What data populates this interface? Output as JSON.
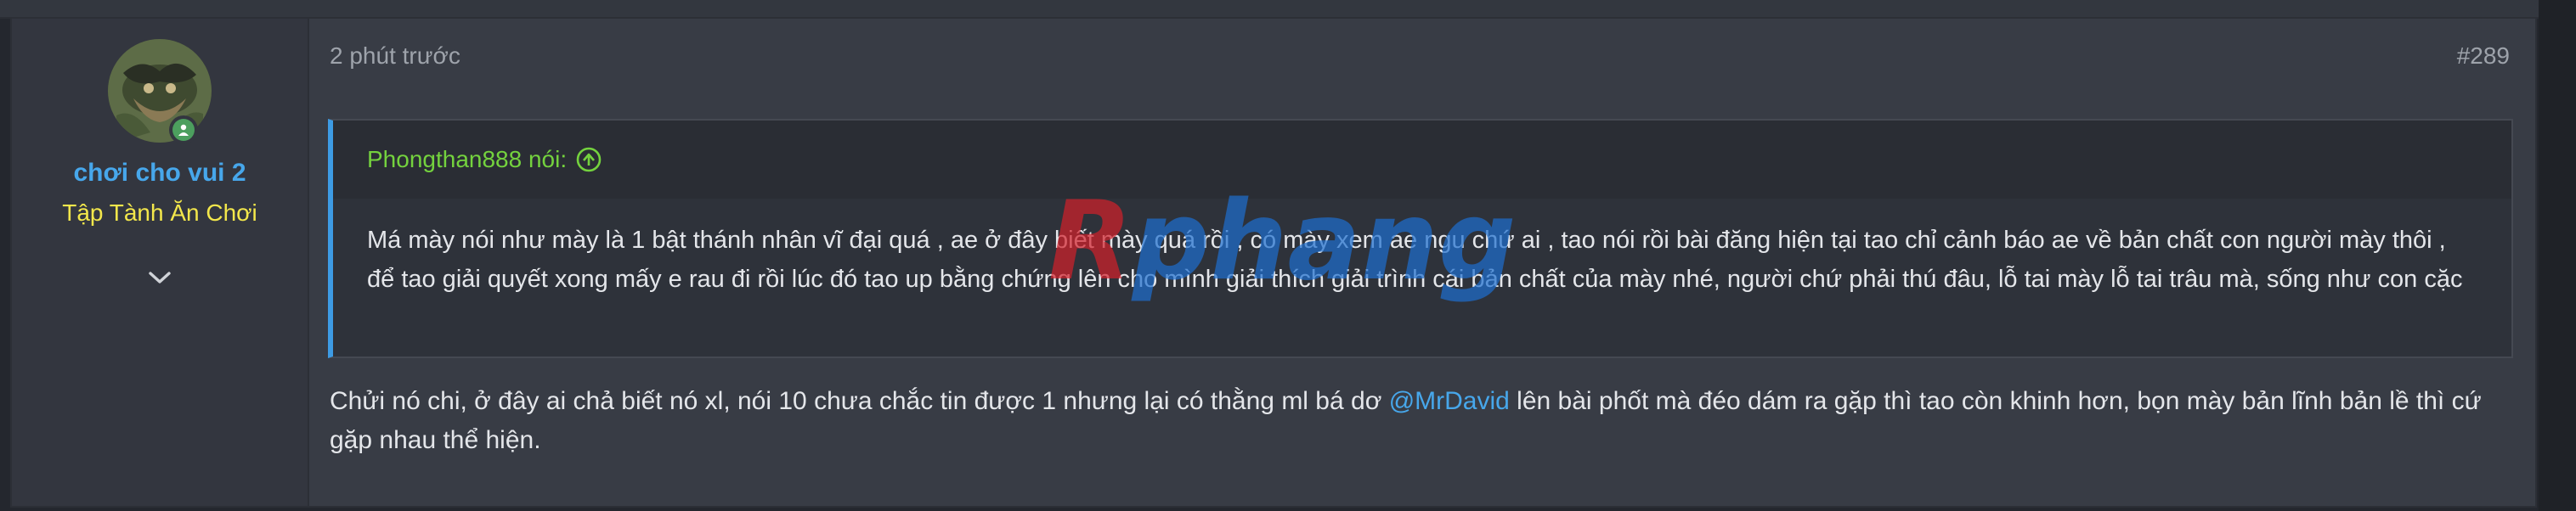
{
  "post": {
    "time": "2 phút trước",
    "number": "#289"
  },
  "user": {
    "name": "chơi cho vui 2",
    "title": "Tập Tành Ăn Chơi"
  },
  "quote": {
    "author": "Phongthan888 nói:",
    "text": "Má mày nói như mày là 1 bật thánh nhân vĩ đại quá , ae ở đây biết mày quá rồi , có mày xem ae ngu chứ ai , tao nói rồi bài đăng hiện tại tao chỉ cảnh báo ae về bản chất con người mày thôi , để tao giải quyết xong mấy e rau đi rồi lúc đó tao up bằng chứng lên cho mình giải thích giải trình cái bản chất của mày nhé, người chứ phải thú đâu, lỗ tai mày lỗ tai trâu mà, sống như con cặc"
  },
  "reply": {
    "before": "Chửi nó chi, ở đây ai chả biết nó xl, nói 10 chưa chắc tin được 1 nhưng lại có thằng ml bá dơ ",
    "mention": "@MrDavid",
    "after": " lên bài phốt mà đéo dám ra gặp thì tao còn khinh hơn, bọn mày bản lĩnh bản lề thì cứ gặp nhau thể hiện."
  },
  "watermark": {
    "text": "Rphang"
  },
  "icons": {
    "online": "online-status-icon",
    "expand": "chevron-down-icon",
    "quote_link": "arrow-up-circle-icon"
  },
  "colors": {
    "username": "#47a7eb",
    "usertitle": "#f3e74b",
    "quote_author": "#74d23e",
    "quote_border": "#3d9be4",
    "mention": "#47a7eb"
  }
}
